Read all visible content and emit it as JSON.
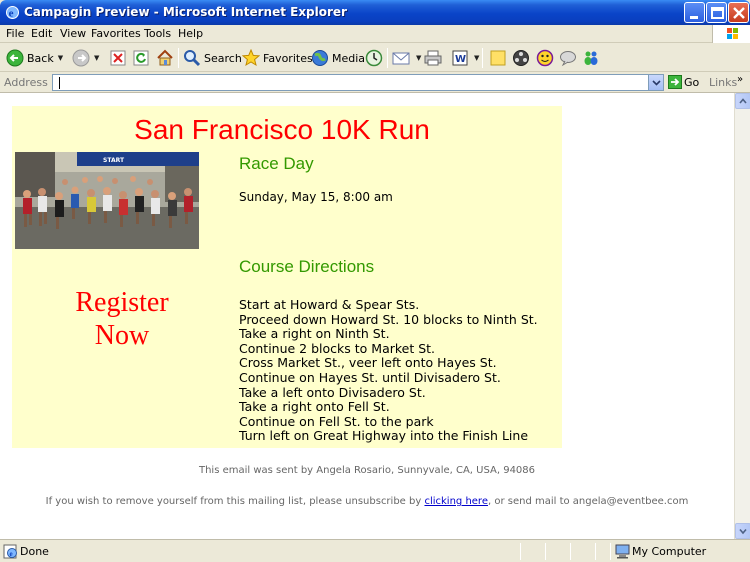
{
  "window": {
    "title": "Campagin Preview - Microsoft Internet Explorer"
  },
  "menu": [
    "File",
    "Edit",
    "View",
    "Favorites",
    "Tools",
    "Help"
  ],
  "toolbar": {
    "back_label": "Back",
    "search_label": "Search",
    "favorites_label": "Favorites",
    "media_label": "Media"
  },
  "address": {
    "label": "Address",
    "value": "",
    "go_label": "Go",
    "links_label": "Links"
  },
  "email": {
    "title": "San Francisco 10K Run",
    "race_heading": "Race Day",
    "race_date": "Sunday, May 15, 8:00 am",
    "register_line1": "Register",
    "register_line2": "Now",
    "directions_heading": "Course Directions",
    "directions": [
      "Start at Howard & Spear Sts.",
      "Proceed down Howard St. 10 blocks to Ninth St.",
      "Take a right on Ninth St.",
      "Continue 2 blocks to Market St.",
      "Cross Market St., veer left onto Hayes St.",
      "Continue on Hayes St. until Divisadero St.",
      "Take a left onto Divisadero St.",
      "Take a right onto Fell St.",
      "Continue on Fell St. to the park",
      "Turn left on Great Highway into the Finish Line"
    ],
    "photo_banner": "START"
  },
  "footer": {
    "sent_text": "This email was sent by Angela Rosario, Sunnyvale, CA, USA, 94086",
    "unsub_prefix": "If you wish to remove yourself from this mailing list, please unsubscribe by ",
    "unsub_link": "clicking here",
    "unsub_suffix": ", or send mail to angela@eventbee.com"
  },
  "status": {
    "text": "Done",
    "zone": "My Computer"
  },
  "colors": {
    "title_red": "#ff0000",
    "heading_green": "#339900",
    "email_background": "#ffffcc",
    "link_blue": "#0000cc"
  }
}
